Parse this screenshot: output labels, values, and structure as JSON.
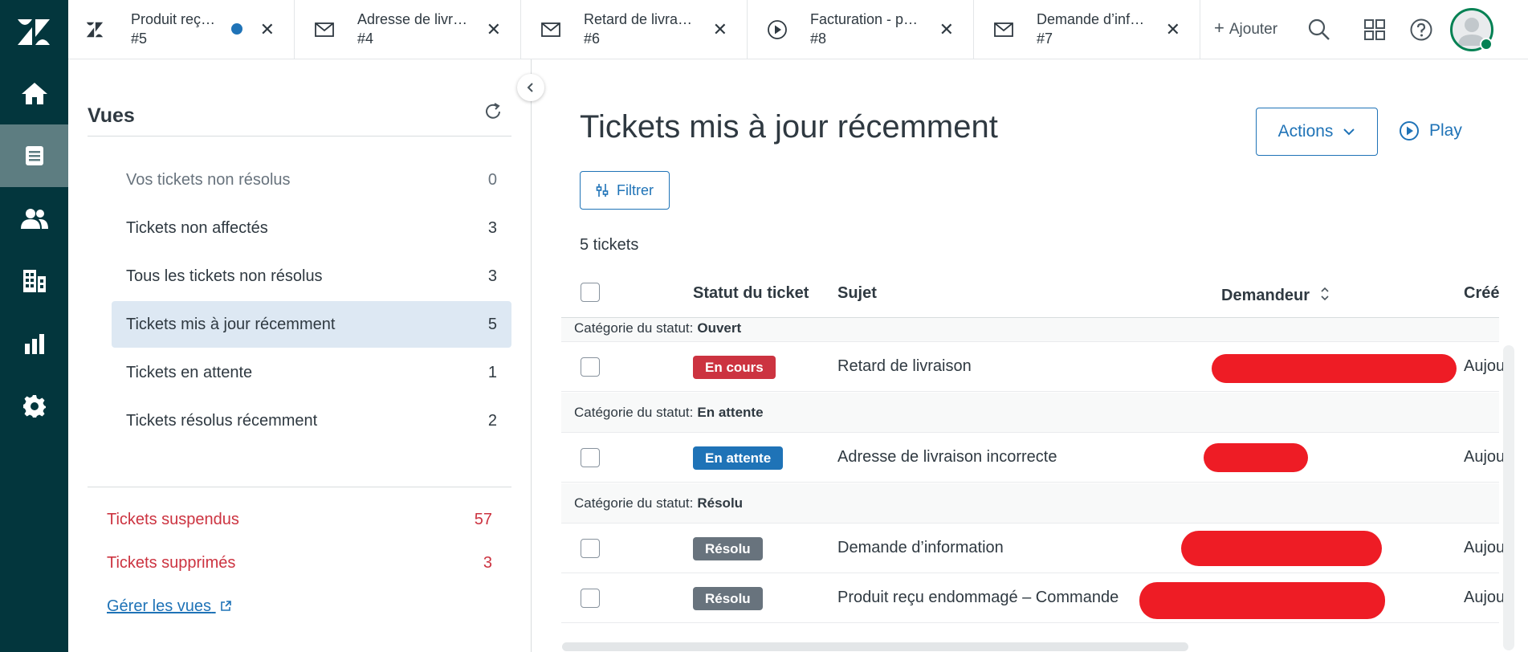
{
  "tabs": [
    {
      "title": "Produit reç…",
      "number": "#5",
      "icon": "zendesk-logo-icon",
      "unread": true
    },
    {
      "title": "Adresse de livr…",
      "number": "#4",
      "icon": "envelope-icon"
    },
    {
      "title": "Retard de livra…",
      "number": "#6",
      "icon": "envelope-icon"
    },
    {
      "title": "Facturation - p…",
      "number": "#8",
      "icon": "play-circle-icon"
    },
    {
      "title": "Demande d’inf…",
      "number": "#7",
      "icon": "envelope-icon"
    }
  ],
  "topbar": {
    "add_label": "Ajouter"
  },
  "views": {
    "title": "Vues",
    "items": [
      {
        "label": "Vos tickets non résolus",
        "count": "0"
      },
      {
        "label": "Tickets non affectés",
        "count": "3"
      },
      {
        "label": "Tous les tickets non résolus",
        "count": "3"
      },
      {
        "label": "Tickets mis à jour récemment",
        "count": "5"
      },
      {
        "label": "Tickets en attente",
        "count": "1"
      },
      {
        "label": "Tickets résolus récemment",
        "count": "2"
      }
    ],
    "special": [
      {
        "label": "Tickets suspendus",
        "count": "57"
      },
      {
        "label": "Tickets supprimés",
        "count": "3"
      }
    ],
    "manage_label": "Gérer les vues"
  },
  "main": {
    "title": "Tickets mis à jour récemment",
    "actions_label": "Actions",
    "play_label": "Play",
    "filter_label": "Filtrer",
    "count_label": "5 tickets",
    "columns": {
      "status": "Statut du ticket",
      "subject": "Sujet",
      "requester": "Demandeur",
      "created": "Créé"
    },
    "group_prefix": "Catégorie du statut:",
    "groups": {
      "open": "Ouvert",
      "pending": "En attente",
      "solved": "Résolu"
    },
    "rows": [
      {
        "status": "En cours",
        "subject": "Retard de livraison",
        "created": "Aujou"
      },
      {
        "status": "En attente",
        "subject": "Adresse de livraison incorrecte",
        "created": "Aujou"
      },
      {
        "status": "Résolu",
        "subject": "Demande d’information",
        "created": "Aujou"
      },
      {
        "status": "Résolu",
        "subject": "Produit reçu endommagé – Commande",
        "created": "Aujou"
      }
    ]
  },
  "colors": {
    "rail": "#03363d",
    "accent": "#1f73b7",
    "status_open": "#cc3340",
    "status_pending": "#1f73b7",
    "status_solved": "#68737d",
    "redaction": "#ee1c25"
  }
}
